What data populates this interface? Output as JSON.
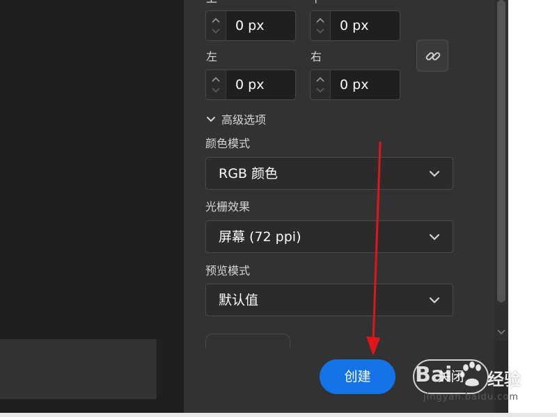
{
  "margins": {
    "top_label": "上",
    "bottom_label": "下",
    "left_label": "左",
    "right_label": "右",
    "top_value": "0 px",
    "bottom_value": "0 px",
    "left_value": "0 px",
    "right_value": "0 px"
  },
  "advanced": {
    "toggle_label": "高级选项",
    "color_mode_label": "颜色模式",
    "color_mode_value": "RGB 颜色",
    "raster_label": "光栅效果",
    "raster_value": "屏幕 (72 ppi)",
    "preview_label": "预览模式",
    "preview_value": "默认值"
  },
  "actions": {
    "create_label": "创建",
    "close_label": "关闭"
  },
  "watermark": {
    "brand_left": "Bai",
    "brand_right": "经验",
    "url": "jingyan.baidu.com"
  },
  "icons": {
    "link": "link-icon",
    "chevron": "chevron-down-icon",
    "stepper": "stepper-arrows-icon"
  },
  "colors": {
    "accent": "#1473e6",
    "annotation_arrow": "#e0161b"
  }
}
